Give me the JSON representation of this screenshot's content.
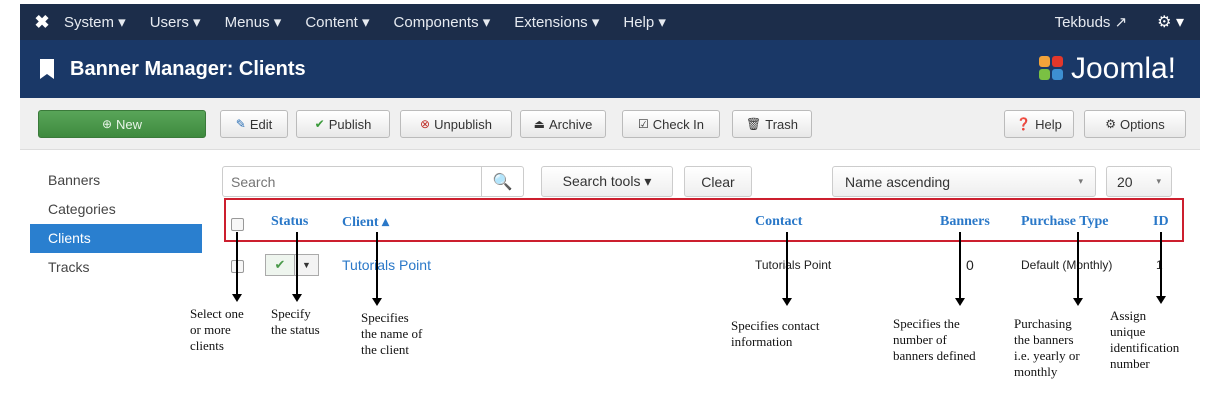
{
  "topnav": {
    "menu": [
      "System ▾",
      "Users ▾",
      "Menus ▾",
      "Content ▾",
      "Components ▾",
      "Extensions ▾",
      "Help ▾"
    ],
    "user": "Tekbuds ↗",
    "gear": "⚙ ▾"
  },
  "header": {
    "title": "Banner Manager: Clients",
    "brand": "Joomla!"
  },
  "toolbar": {
    "new": "New",
    "edit": "Edit",
    "publish": "Publish",
    "unpublish": "Unpublish",
    "archive": "Archive",
    "checkin": "Check In",
    "trash": "Trash",
    "help": "Help",
    "options": "Options"
  },
  "sidebar": {
    "items": [
      {
        "label": "Banners"
      },
      {
        "label": "Categories"
      },
      {
        "label": "Clients"
      },
      {
        "label": "Tracks"
      }
    ]
  },
  "filters": {
    "search_placeholder": "Search",
    "search_tools": "Search tools ▾",
    "clear": "Clear",
    "sort": "Name ascending",
    "limit": "20"
  },
  "table": {
    "headers": {
      "status": "Status",
      "client": "Client ▴",
      "contact": "Contact",
      "banners": "Banners",
      "purchase_type": "Purchase Type",
      "id": "ID"
    },
    "rows": [
      {
        "client": "Tutorials Point",
        "contact": "Tutorials Point",
        "banners": "0",
        "purchase_type": "Default (Monthly)",
        "id": "1"
      }
    ]
  },
  "annotations": {
    "select": "Select one\nor more\nclients",
    "status": "Specify\nthe status",
    "client": "Specifies\nthe name of\nthe client",
    "contact": "Specifies contact\ninformation",
    "banners": "Specifies the\nnumber of\nbanners defined",
    "purchase": "Purchasing\nthe banners\ni.e. yearly or\nmonthly",
    "id": "Assign\nunique\nidentification\nnumber"
  },
  "colors": {
    "nav": "#1c2d4a",
    "header": "#1a3867",
    "accent": "#2a7fcf",
    "highlight": "#cc1f2e",
    "new_button": "#4a994a"
  }
}
